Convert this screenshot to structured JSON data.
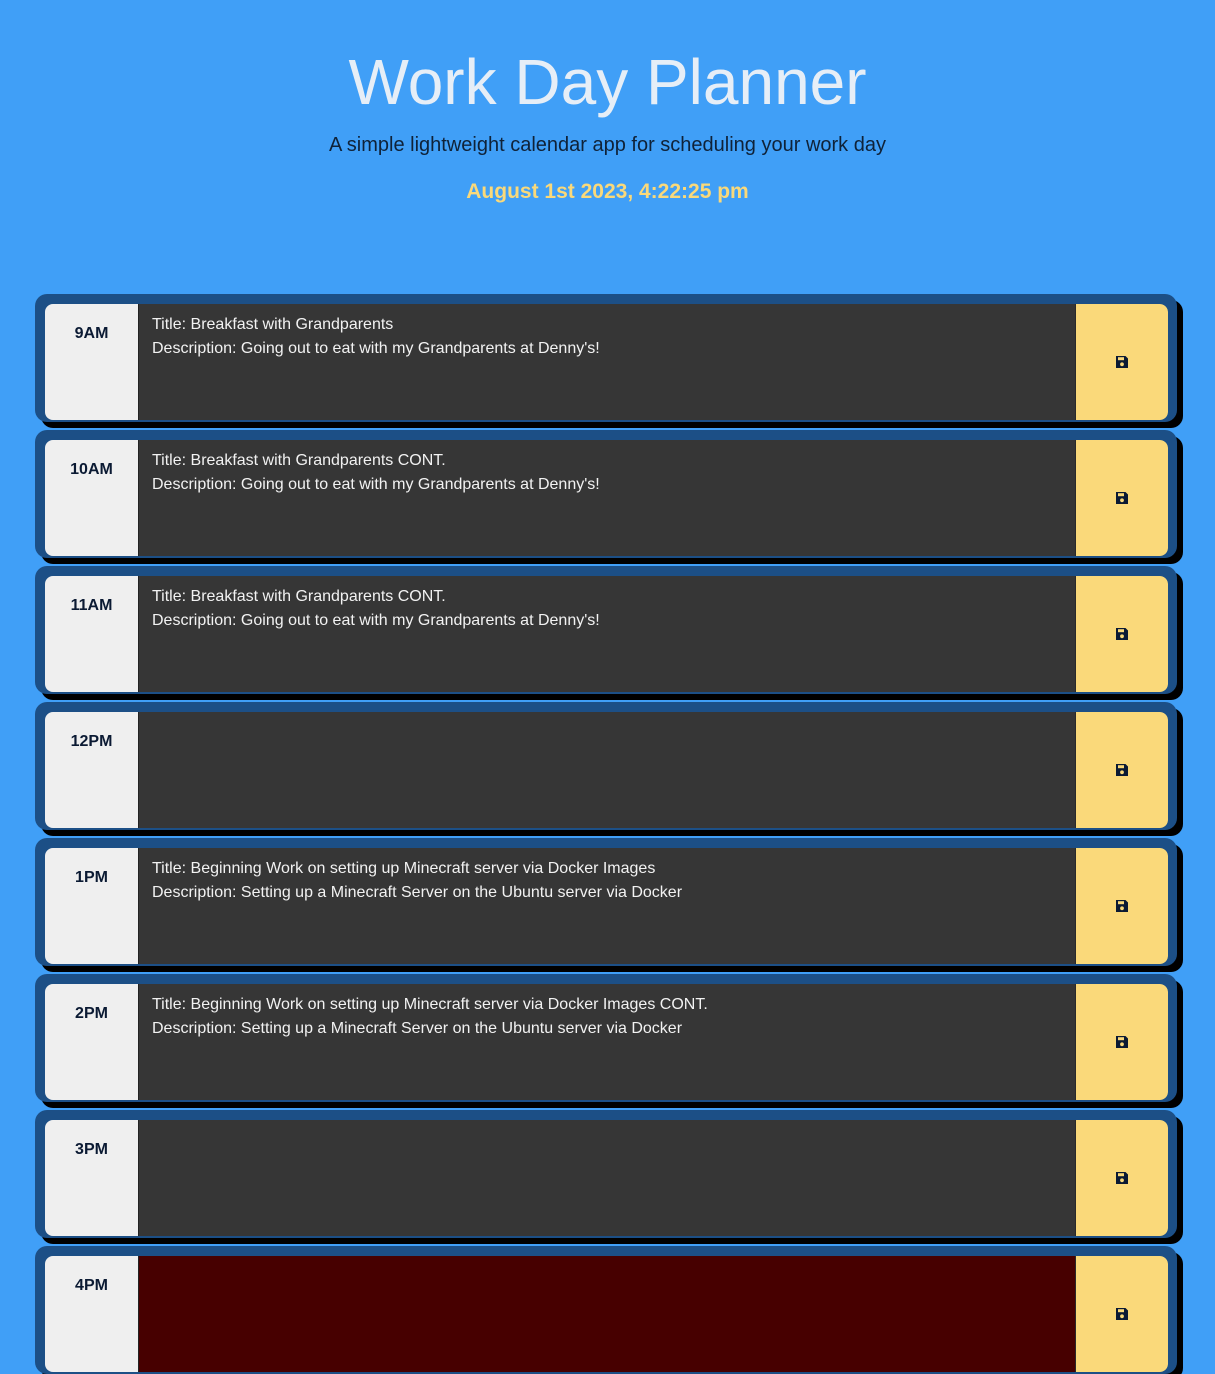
{
  "header": {
    "title": "Work Day Planner",
    "subtitle": "A simple lightweight calendar app for scheduling your work day",
    "datetime": "August 1st 2023, 4:22:25 pm"
  },
  "colors": {
    "background": "#409ff7",
    "row_frame": "#1c4f86",
    "past_entry": "#363636",
    "present_entry": "#470000",
    "save_button": "#fad97a",
    "hour_cell": "#efefef"
  },
  "rows": [
    {
      "hour": "9AM",
      "text": "Title: Breakfast with Grandparents\nDescription: Going out to eat with my Grandparents at Denny's!",
      "icon": "floppy-disk-icon"
    },
    {
      "hour": "10AM",
      "text": "Title: Breakfast with Grandparents CONT.\nDescription: Going out to eat with my Grandparents at Denny's!",
      "icon": "floppy-disk-icon"
    },
    {
      "hour": "11AM",
      "text": "Title: Breakfast with Grandparents CONT.\nDescription: Going out to eat with my Grandparents at Denny's!",
      "icon": "floppy-disk-icon"
    },
    {
      "hour": "12PM",
      "text": "",
      "icon": "floppy-disk-icon"
    },
    {
      "hour": "1PM",
      "text": "Title: Beginning Work on setting up Minecraft server via Docker Images\nDescription: Setting up a Minecraft Server on the Ubuntu server via Docker",
      "icon": "floppy-disk-icon"
    },
    {
      "hour": "2PM",
      "text": "Title: Beginning Work on setting up Minecraft server via Docker Images CONT.\nDescription: Setting up a Minecraft Server on the Ubuntu server via Docker",
      "icon": "floppy-disk-icon"
    },
    {
      "hour": "3PM",
      "text": "",
      "icon": "floppy-disk-icon"
    },
    {
      "hour": "4PM",
      "text": "",
      "icon": "floppy-disk-icon"
    }
  ]
}
